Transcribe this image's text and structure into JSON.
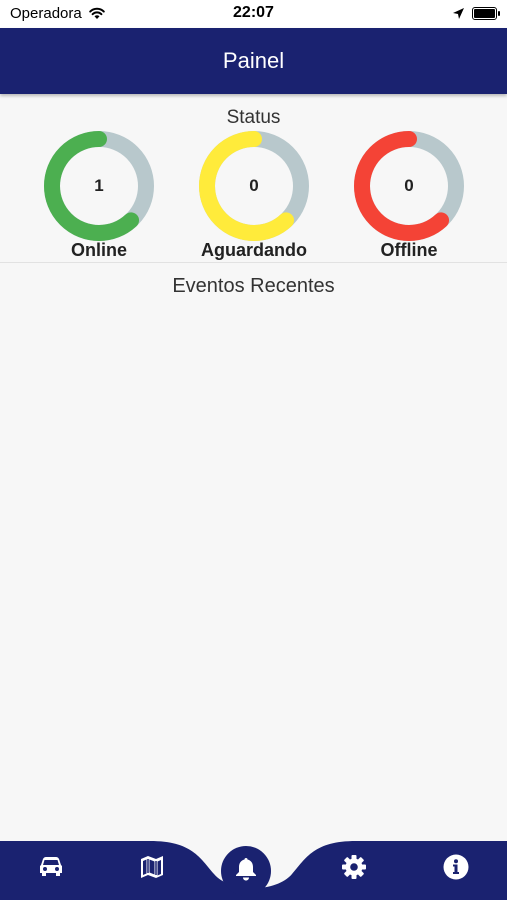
{
  "status_bar": {
    "carrier": "Operadora",
    "time": "22:07",
    "battery_level": 1.0
  },
  "app_bar": {
    "title": "Painel"
  },
  "status_section": {
    "title": "Status",
    "gauges": [
      {
        "label": "Online",
        "value": "1",
        "fill_fraction": 0.62,
        "color": "#4caf50",
        "track_color": "#b8c8cc"
      },
      {
        "label": "Aguardando",
        "value": "0",
        "fill_fraction": 0.62,
        "color": "#ffeb3b",
        "track_color": "#b8c8cc"
      },
      {
        "label": "Offline",
        "value": "0",
        "fill_fraction": 0.62,
        "color": "#f44336",
        "track_color": "#b8c8cc"
      }
    ]
  },
  "events_section": {
    "title": "Eventos Recentes",
    "items": []
  },
  "bottom_nav": {
    "background_color": "#1a2270",
    "items": [
      {
        "icon": "car-icon"
      },
      {
        "icon": "map-icon"
      },
      {
        "icon": "bell-icon",
        "active": true
      },
      {
        "icon": "gear-icon"
      },
      {
        "icon": "info-icon"
      }
    ]
  }
}
